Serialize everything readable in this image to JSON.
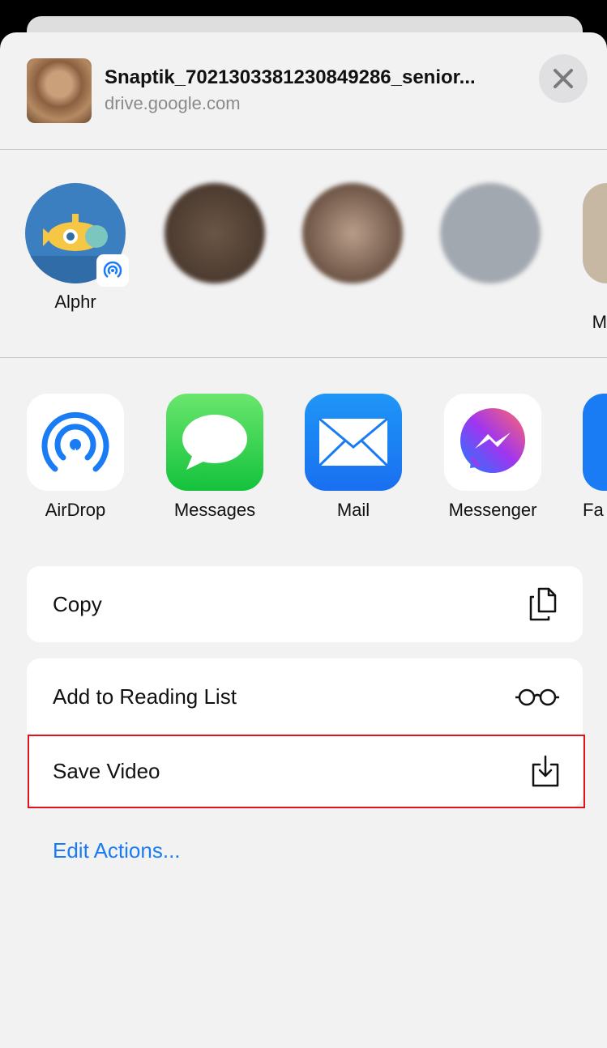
{
  "header": {
    "title": "Snaptik_7021303381230849286_senior...",
    "subtitle": "drive.google.com"
  },
  "contacts": [
    {
      "label": "Alphr"
    },
    {
      "label": ""
    },
    {
      "label": ""
    },
    {
      "label": ""
    },
    {
      "label": "M"
    }
  ],
  "apps": [
    {
      "label": "AirDrop"
    },
    {
      "label": "Messages"
    },
    {
      "label": "Mail"
    },
    {
      "label": "Messenger"
    },
    {
      "label": "Fa"
    }
  ],
  "actions": {
    "copy": "Copy",
    "reading_list": "Add to Reading List",
    "save_video": "Save Video",
    "edit": "Edit Actions..."
  },
  "colors": {
    "accent": "#1a7cf5",
    "highlight": "#e0131b"
  }
}
